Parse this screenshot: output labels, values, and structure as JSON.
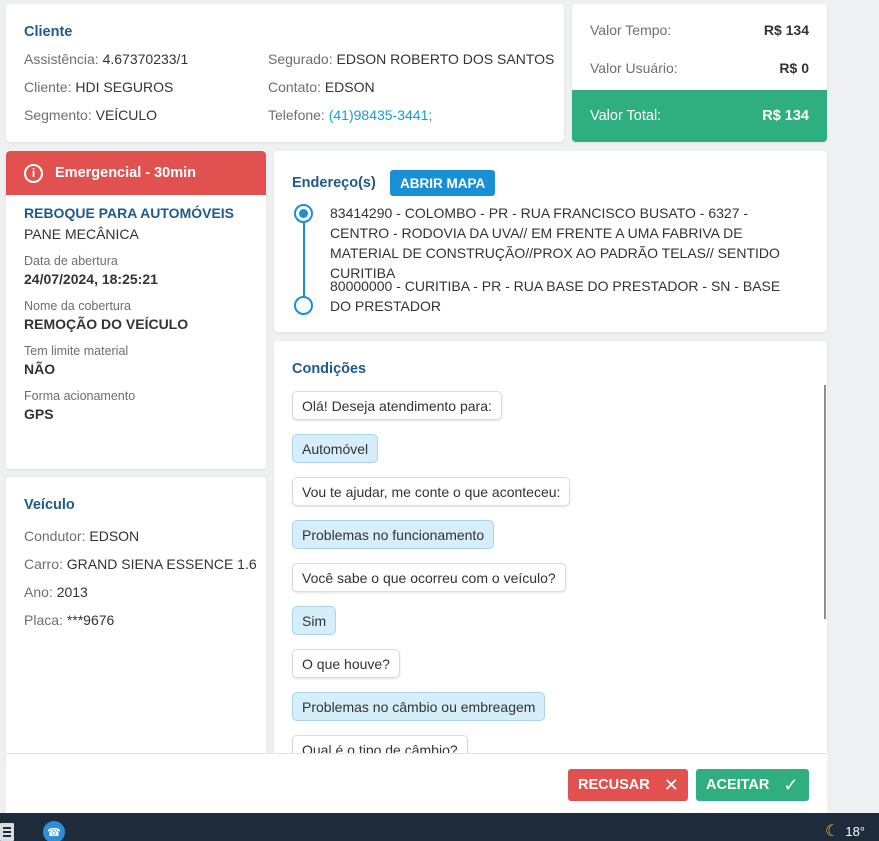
{
  "cliente": {
    "title": "Cliente",
    "assistencia_label": "Assistência:",
    "assistencia_value": "4.67370233/1",
    "cliente_label": "Cliente:",
    "cliente_value": "HDI SEGUROS",
    "segmento_label": "Segmento:",
    "segmento_value": "VEÍCULO",
    "segurado_label": "Segurado:",
    "segurado_value": "EDSON ROBERTO DOS SANTOS",
    "contato_label": "Contato:",
    "contato_value": "EDSON",
    "telefone_label": "Telefone:",
    "telefone_value": "(41)98435-3441;"
  },
  "valores": {
    "tempo_label": "Valor Tempo:",
    "tempo_value": "R$ 134",
    "usuario_label": "Valor Usuário:",
    "usuario_value": "R$ 0",
    "total_label": "Valor Total:",
    "total_value": "R$ 134"
  },
  "servico": {
    "badge_icon": "i",
    "badge": "Emergencial - 30min",
    "tipo": "REBOQUE PARA AUTOMÓVEIS",
    "subtipo": "PANE MECÂNICA",
    "abertura_label": "Data de abertura",
    "abertura_value": "24/07/2024, 18:25:21",
    "cobertura_label": "Nome da cobertura",
    "cobertura_value": "REMOÇÃO DO VEÍCULO",
    "limite_label": "Tem limite material",
    "limite_value": "NÃO",
    "forma_label": "Forma acionamento",
    "forma_value": "GPS"
  },
  "veiculo": {
    "title": "Veículo",
    "condutor_label": "Condutor:",
    "condutor_value": "EDSON",
    "carro_label": "Carro:",
    "carro_value": "GRAND SIENA ESSENCE 1.6",
    "ano_label": "Ano:",
    "ano_value": "2013",
    "placa_label": "Placa:",
    "placa_value": "***9676"
  },
  "endereco": {
    "title": "Endereço(s)",
    "map_button": "ABRIR MAPA",
    "origem": "83414290 - COLOMBO - PR - RUA FRANCISCO BUSATO - 6327 - CENTRO - RODOVIA DA UVA// EM FRENTE A UMA FABRIVA DE MATERIAL DE CONSTRUÇÃO//PROX AO PADRÃO TELAS// SENTIDO CURITIBA",
    "destino": "80000000 - CURITIBA - PR - RUA BASE DO PRESTADOR - SN - BASE DO PRESTADOR"
  },
  "condicoes": {
    "title": "Condições",
    "messages": [
      {
        "role": "q",
        "text": "Olá! Deseja atendimento para:"
      },
      {
        "role": "a",
        "text": "Automóvel"
      },
      {
        "role": "q",
        "text": "Vou te ajudar, me conte o que aconteceu:"
      },
      {
        "role": "a",
        "text": "Problemas no funcionamento"
      },
      {
        "role": "q",
        "text": "Você sabe o que ocorreu com o veículo?"
      },
      {
        "role": "a",
        "text": "Sim"
      },
      {
        "role": "q",
        "text": "O que houve?"
      },
      {
        "role": "a",
        "text": "Problemas no câmbio ou embreagem"
      },
      {
        "role": "q",
        "text": "Qual é o tipo de câmbio?"
      }
    ]
  },
  "footer": {
    "recusar": "RECUSAR",
    "recusar_icon": "✕",
    "aceitar": "ACEITAR",
    "aceitar_icon": "✓"
  },
  "taskbar": {
    "temperature": "18°"
  },
  "colors": {
    "primary_title": "#1e5a8a",
    "link": "#1a9ad6",
    "success": "#2fae7f",
    "danger": "#e0514f",
    "answer_bubble": "#d6eef9"
  },
  "icons": {
    "emergency": "info-circle-icon",
    "map_point_origin": "filled-circle-icon",
    "map_point_destination": "empty-circle-icon",
    "recusar": "close-icon",
    "aceitar": "check-icon",
    "taskbar_calc": "calculator-icon",
    "taskbar_phone": "phone-app-icon",
    "taskbar_weather": "moon-icon"
  }
}
